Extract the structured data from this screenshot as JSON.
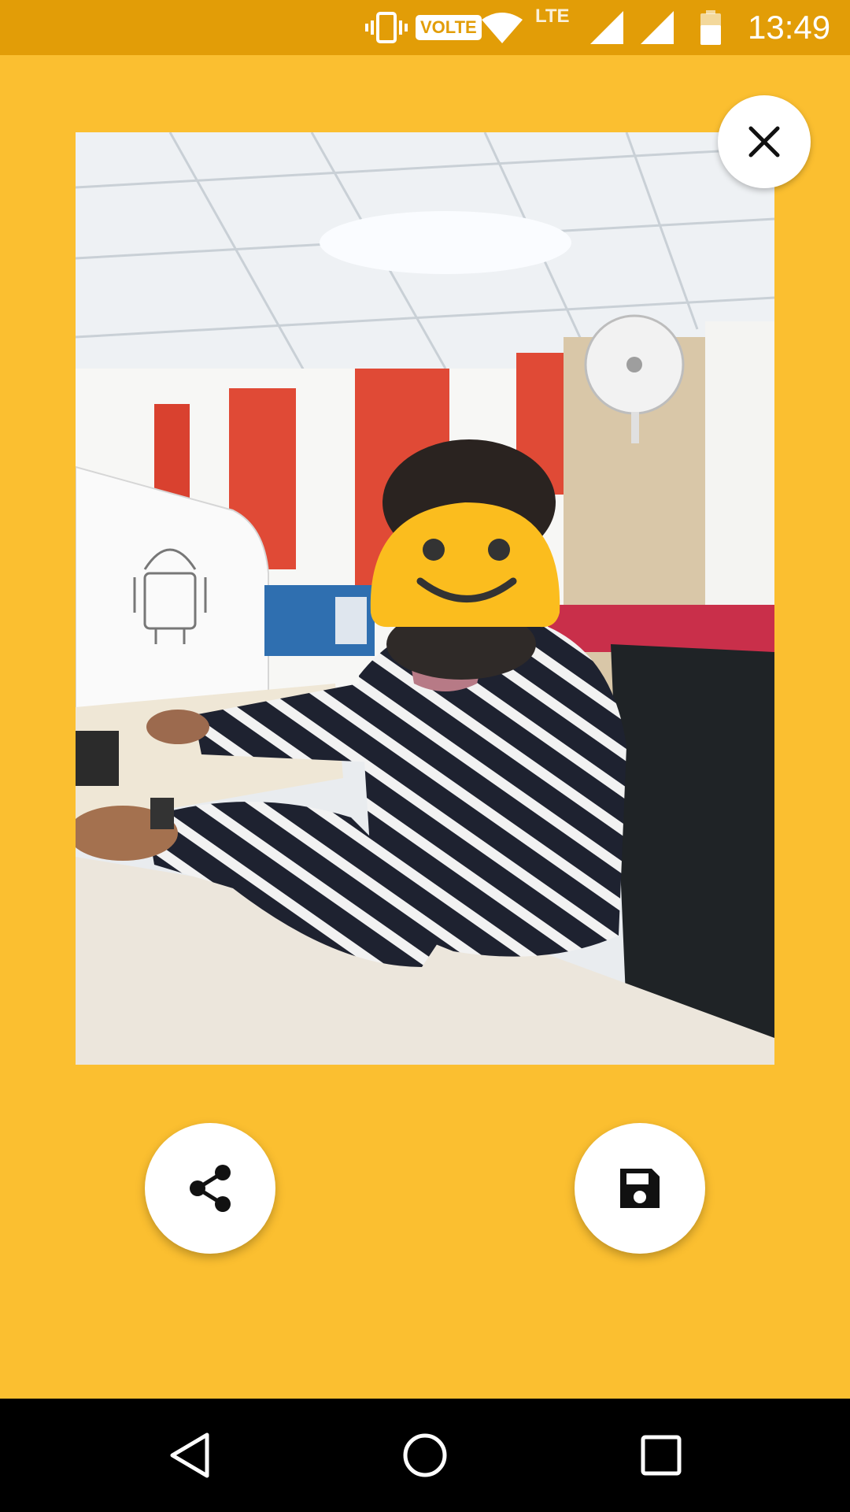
{
  "status_bar": {
    "volte_label": "VOLTE",
    "lte_label": "LTE",
    "time": "13:49",
    "icons": [
      "vibrate-icon",
      "volte-icon",
      "wifi-icon",
      "signal-icon",
      "signal-icon",
      "battery-icon"
    ]
  },
  "photo": {
    "description_icon": "photo-image",
    "face_overlay": "smiley-sticker"
  },
  "buttons": {
    "close_icon": "close-icon",
    "share_icon": "share-icon",
    "save_icon": "save-icon"
  },
  "nav_bar": {
    "icons": [
      "back-icon",
      "home-icon",
      "recents-icon"
    ]
  },
  "colors": {
    "background": "#FBBF30",
    "status_bar": "#E29D07",
    "button": "#FFFFFF",
    "nav_bar": "#000000"
  }
}
